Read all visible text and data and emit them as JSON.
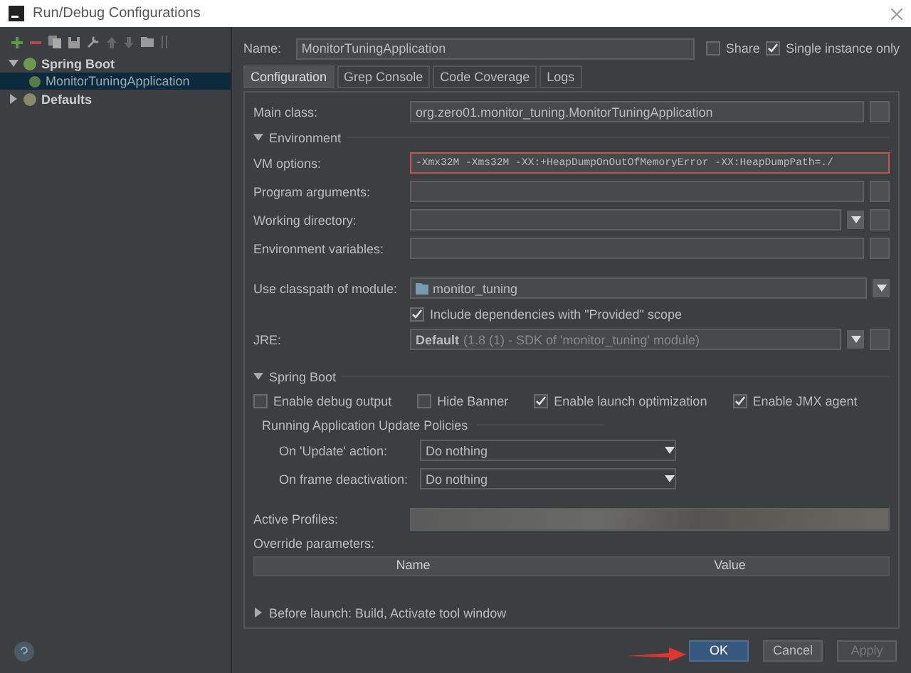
{
  "window": {
    "title": "Run/Debug Configurations"
  },
  "tree": [
    {
      "label": "Spring Boot",
      "expanded": true,
      "children": [
        {
          "label": "MonitorTuningApplication",
          "selected": true
        }
      ]
    },
    {
      "label": "Defaults",
      "expanded": false
    }
  ],
  "name_field": {
    "label": "Name:",
    "value": "MonitorTuningApplication"
  },
  "options": [
    {
      "label": "Share",
      "checked": false
    },
    {
      "label": "Single instance only",
      "checked": true
    }
  ],
  "tabs": [
    {
      "label": "Configuration",
      "selected": true
    },
    {
      "label": "Grep Console",
      "selected": false
    },
    {
      "label": "Code Coverage",
      "selected": false
    },
    {
      "label": "Logs",
      "selected": false
    }
  ],
  "main_class": {
    "label": "Main class:",
    "value": "org.zero01.monitor_tuning.MonitorTuningApplication"
  },
  "environment": {
    "label": "Environment",
    "expanded": true,
    "fields": [
      {
        "kind": "text",
        "label": "VM options:",
        "value": "-Xmx32M -Xms32M -XX:+HeapDumpOnOutOfMemoryError -XX:HeapDumpPath=./",
        "highlighted": true
      },
      {
        "kind": "text",
        "label": "Program arguments:",
        "highlighted": false
      },
      {
        "kind": "dropdown",
        "label": "Working directory:",
        "highlighted": false
      },
      {
        "kind": "text",
        "label": "Environment variables:",
        "highlighted": false
      }
    ]
  },
  "classpath": {
    "label": "Use classpath of module:",
    "value": "monitor_tuning"
  },
  "include_dependencies": {
    "label": "Include dependencies with \"Provided\" scope",
    "checked": true
  },
  "jre": {
    "label": "JRE:",
    "value": "Default",
    "hint": "(1.8 (1) - SDK of 'monitor_tuning' module)"
  },
  "spring_boot": {
    "label": "Spring Boot",
    "expanded": true,
    "checkboxes": [
      {
        "label": "Enable debug output",
        "checked": false
      },
      {
        "label": "Hide Banner",
        "checked": false
      },
      {
        "label": "Enable launch optimization",
        "checked": true
      },
      {
        "label": "Enable JMX agent",
        "checked": true
      }
    ],
    "policies": {
      "title": "Running Application Update Policies",
      "selects": [
        {
          "label": "On 'Update' action:",
          "value": "Do nothing"
        },
        {
          "label": "On frame deactivation:",
          "value": "Do nothing"
        }
      ]
    },
    "active_profiles": {
      "label": "Active Profiles:"
    },
    "override_parameters": {
      "label": "Override parameters:",
      "columns": [
        "Name",
        "Value"
      ]
    }
  },
  "before_launch": {
    "label": "Before launch: Build, Activate tool window",
    "expanded": false
  },
  "buttons": [
    {
      "label": "OK",
      "kind": "primary"
    },
    {
      "label": "Cancel",
      "kind": "normal"
    },
    {
      "label": "Apply",
      "kind": "disabled"
    }
  ]
}
